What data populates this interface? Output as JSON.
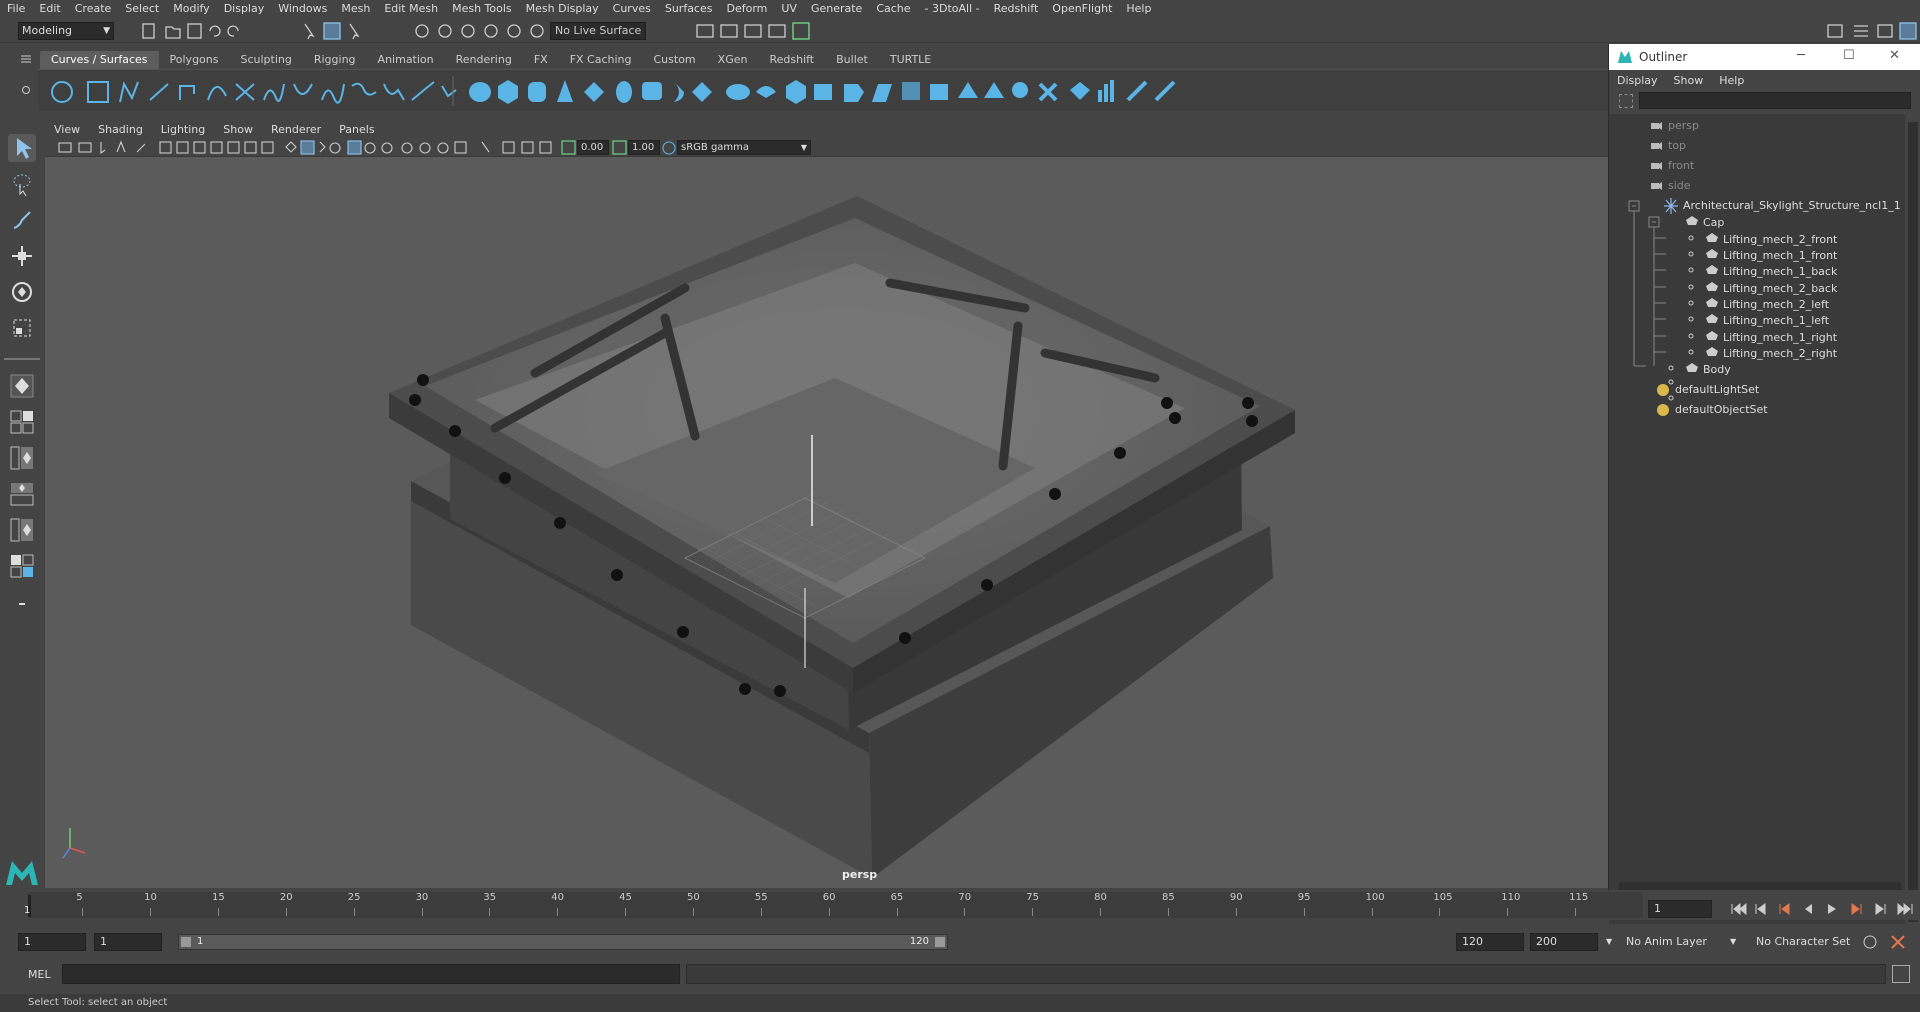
{
  "menubar": [
    "File",
    "Edit",
    "Create",
    "Select",
    "Modify",
    "Display",
    "Windows",
    "Mesh",
    "Edit Mesh",
    "Mesh Tools",
    "Mesh Display",
    "Curves",
    "Surfaces",
    "Deform",
    "UV",
    "Generate",
    "Cache",
    "- 3DtoAll -",
    "Redshift",
    "OpenFlight",
    "Help"
  ],
  "statusline": {
    "mode": "Modeling",
    "live_surface": "No Live Surface"
  },
  "shelf_tabs": [
    "Curves / Surfaces",
    "Polygons",
    "Sculpting",
    "Rigging",
    "Animation",
    "Rendering",
    "FX",
    "FX Caching",
    "Custom",
    "XGen",
    "Redshift",
    "Bullet",
    "TURTLE"
  ],
  "panel_menu": [
    "View",
    "Shading",
    "Lighting",
    "Show",
    "Renderer",
    "Panels"
  ],
  "panel_bar": {
    "exposure": "0.00",
    "gamma": "1.00",
    "color_space": "sRGB gamma"
  },
  "viewport": {
    "camera_label": "persp"
  },
  "outliner": {
    "title": "Outliner",
    "menu": [
      "Display",
      "Show",
      "Help"
    ],
    "items": [
      {
        "label": "persp",
        "dim": true
      },
      {
        "label": "top",
        "dim": true
      },
      {
        "label": "front",
        "dim": true
      },
      {
        "label": "side",
        "dim": true
      },
      {
        "label": "Architectural_Skylight_Structure_ncl1_1"
      },
      {
        "label": "Cap"
      },
      {
        "label": "Lifting_mech_2_front"
      },
      {
        "label": "Lifting_mech_1_front"
      },
      {
        "label": "Lifting_mech_1_back"
      },
      {
        "label": "Lifting_mech_2_back"
      },
      {
        "label": "Lifting_mech_2_left"
      },
      {
        "label": "Lifting_mech_1_left"
      },
      {
        "label": "Lifting_mech_1_right"
      },
      {
        "label": "Lifting_mech_2_right"
      },
      {
        "label": "Body"
      },
      {
        "label": "defaultLightSet"
      },
      {
        "label": "defaultObjectSet"
      }
    ]
  },
  "timeline": {
    "ticks": [
      "5",
      "10",
      "15",
      "20",
      "25",
      "30",
      "35",
      "40",
      "45",
      "50",
      "55",
      "60",
      "65",
      "70",
      "75",
      "80",
      "85",
      "90",
      "95",
      "100",
      "105",
      "110",
      "115"
    ],
    "current_frame": "1",
    "current_frame_start": "1",
    "range_start_a": "1",
    "range_start_b": "1",
    "range_handle_start": "1",
    "range_handle_end": "120",
    "range_end": "120",
    "anim_end": "200",
    "anim_layer": "No Anim Layer",
    "character_set": "No Character Set"
  },
  "command_line": {
    "label": "MEL"
  },
  "help_line": "Select Tool: select an object",
  "colors": {
    "accent": "#5ab4e6",
    "viewport_bg": "#5b5b5b",
    "ui_bg": "#444444"
  }
}
